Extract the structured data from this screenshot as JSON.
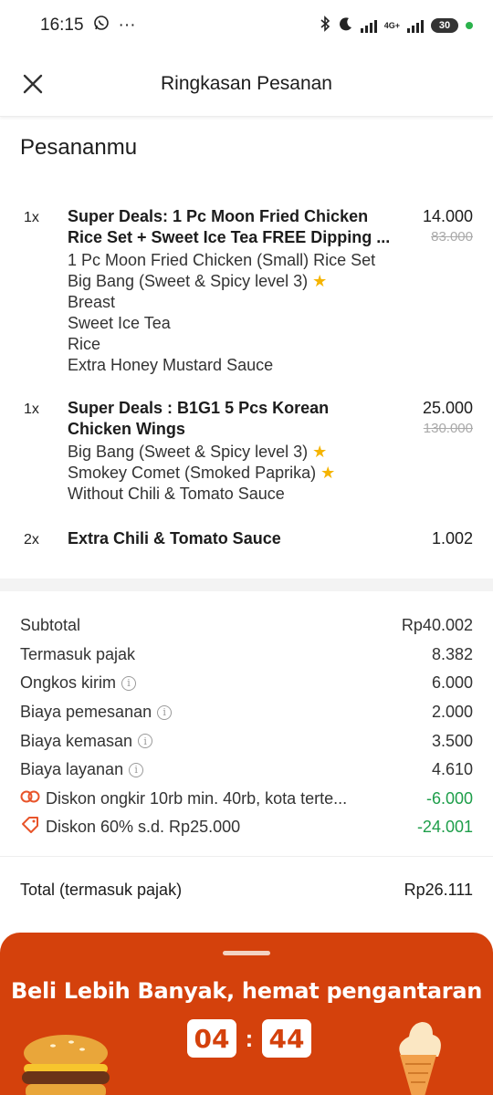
{
  "status_bar": {
    "time": "16:15",
    "dots": "···",
    "network": "4G+",
    "battery": "30"
  },
  "header": {
    "title": "Ringkasan Pesanan"
  },
  "section_title": "Pesananmu",
  "items": [
    {
      "qty": "1x",
      "name_lines": [
        "Super Deals: 1 Pc Moon Fried Chicken",
        "Rice Set + Sweet Ice Tea FREE Dipping ..."
      ],
      "price": "14.000",
      "original_price": "83.000",
      "options": [
        "1 Pc Moon Fried Chicken (Small) Rice Set",
        "Big Bang (Sweet & Spicy level 3) ⭐",
        "Breast",
        "Sweet Ice Tea",
        "Rice",
        "Extra Honey Mustard Sauce"
      ]
    },
    {
      "qty": "1x",
      "name_lines": [
        "Super Deals : B1G1 5 Pcs Korean",
        "Chicken Wings"
      ],
      "price": "25.000",
      "original_price": "130.000",
      "options": [
        "Big Bang (Sweet & Spicy level 3) ⭐",
        "Smokey Comet (Smoked Paprika) ⭐",
        "Without Chili & Tomato Sauce"
      ]
    },
    {
      "qty": "2x",
      "name_lines": [
        "Extra Chili & Tomato Sauce"
      ],
      "price": "1.002"
    }
  ],
  "summary": {
    "subtotal": {
      "label": "Subtotal",
      "value": "Rp40.002"
    },
    "tax": {
      "label": "Termasuk pajak",
      "value": "8.382"
    },
    "delivery": {
      "label": "Ongkos kirim",
      "value": "6.000"
    },
    "order_fee": {
      "label": "Biaya pemesanan",
      "value": "2.000"
    },
    "packaging": {
      "label": "Biaya kemasan",
      "value": "3.500"
    },
    "service": {
      "label": "Biaya layanan",
      "value": "4.610"
    },
    "discount_delivery": {
      "label": "Diskon ongkir 10rb min. 40rb, kota terte...",
      "value": "-6.000"
    },
    "discount_promo": {
      "label": "Diskon 60% s.d. Rp25.000",
      "value": "-24.001"
    }
  },
  "total": {
    "label": "Total (termasuk pajak)",
    "value": "Rp26.111"
  },
  "promo": {
    "title": "Beli Lebih Banyak, hemat pengantaran",
    "timer_minutes": "04",
    "timer_colon": ":",
    "timer_seconds": "44"
  },
  "colors": {
    "accent": "#d4410c",
    "discount_green": "#1e9e4a",
    "star": "#f5b400"
  }
}
